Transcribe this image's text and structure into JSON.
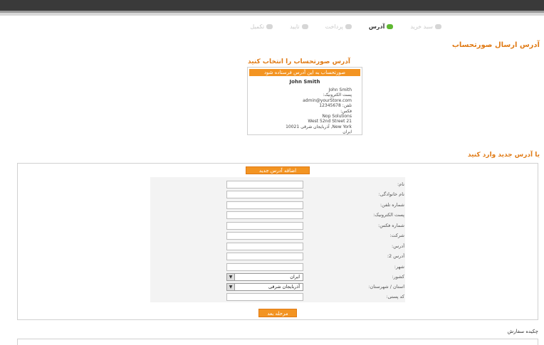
{
  "steps": [
    {
      "label": "سبد خرید",
      "active": false
    },
    {
      "label": "آدرس",
      "active": true
    },
    {
      "label": "پرداخت",
      "active": false
    },
    {
      "label": "تایید",
      "active": false
    },
    {
      "label": "تکمیل",
      "active": false
    }
  ],
  "page_title": "آدرس ارسال صورتحساب",
  "select_title": "آدرس صورتحساب را انتخاب کنید",
  "address_card": {
    "button_label": "صورتحساب به این آدرس فرستاده شود",
    "name": "John Smith",
    "lines": [
      "John  Smith",
      "پست الکترونیک:",
      "admin@yourStore.com",
      "تلفن:    12345678",
      "فکس:",
      "Nop Solutions",
      "21   West 52nd Street",
      "New York, آذربایجان شرقی  10021",
      "ایران"
    ]
  },
  "new_address_title": "یا آدرس جدید وارد کنید",
  "new_address_button": "اضافه آدرس جدید",
  "form": {
    "fields": [
      {
        "label": "نام:",
        "type": "text",
        "value": ""
      },
      {
        "label": "نام خانوادگی:",
        "type": "text",
        "value": ""
      },
      {
        "label": "شماره تلفن:",
        "type": "text",
        "value": ""
      },
      {
        "label": "پست الکترونیک:",
        "type": "text",
        "value": ""
      },
      {
        "label": "شماره فکس:",
        "type": "text",
        "value": ""
      },
      {
        "label": "شرکت:",
        "type": "text",
        "value": ""
      },
      {
        "label": "آدرس:",
        "type": "text",
        "value": ""
      },
      {
        "label": "آدرس 2:",
        "type": "text",
        "value": ""
      },
      {
        "label": "شهر:",
        "type": "text",
        "value": ""
      },
      {
        "label": "کشور:",
        "type": "select",
        "value": "ایران"
      },
      {
        "label": "استان / شهرستان:",
        "type": "select",
        "value": "آذربایجان شرقی"
      },
      {
        "label": "کد پستی:",
        "type": "text",
        "value": ""
      }
    ],
    "next_button": "مرحله بعد"
  },
  "summary_title": "چکیده سفارش"
}
